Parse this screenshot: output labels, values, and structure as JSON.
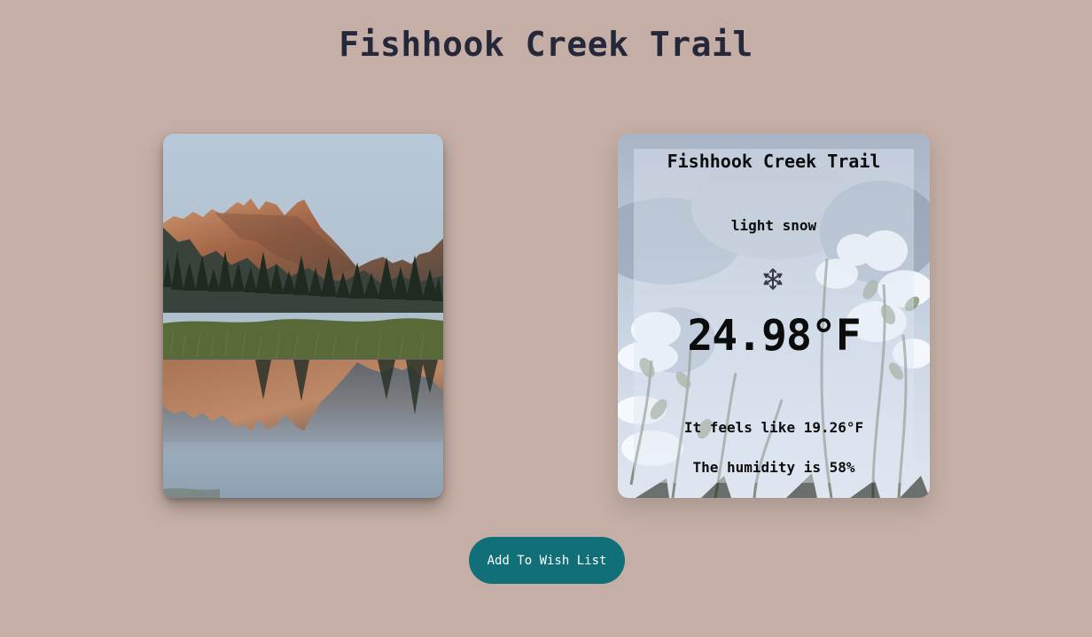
{
  "page": {
    "title": "Fishhook Creek Trail"
  },
  "photo": {
    "name": "mountain-lake-photo"
  },
  "weather": {
    "location": "Fishhook Creek Trail",
    "description": "light snow",
    "icon": "snowflake-icon",
    "temperature": "24.98°F",
    "feels_like": "It feels like 19.26°F",
    "humidity": "The humidity is 58%"
  },
  "actions": {
    "wishlist_label": "Add To Wish List"
  },
  "colors": {
    "background": "#c4aea5",
    "title": "#25283a",
    "button": "#116f78",
    "button_text": "#ffffff",
    "weather_text": "#0c0c0c"
  }
}
